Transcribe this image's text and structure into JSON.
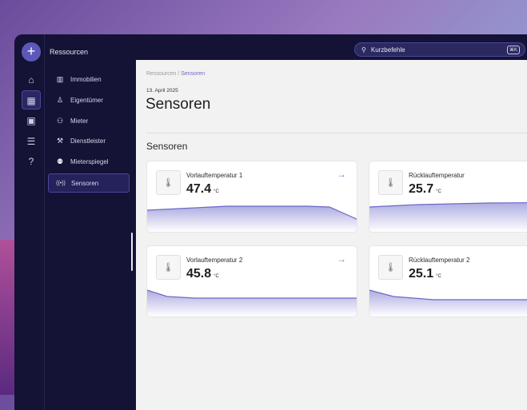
{
  "rail": {
    "add_label": "+",
    "items": [
      {
        "icon": "home-icon",
        "glyph": "⌂"
      },
      {
        "icon": "grid-icon",
        "glyph": "▦",
        "active": true
      },
      {
        "icon": "wallet-icon",
        "glyph": "▣"
      },
      {
        "icon": "sliders-icon",
        "glyph": "☰"
      },
      {
        "icon": "help-icon",
        "glyph": "?"
      }
    ]
  },
  "nav": {
    "title": "Ressourcen",
    "items": [
      {
        "label": "Immobilien",
        "icon": "building-icon",
        "glyph": "▥"
      },
      {
        "label": "Eigentümer",
        "icon": "user-icon",
        "glyph": "♙"
      },
      {
        "label": "Mieter",
        "icon": "users-icon",
        "glyph": "⚇"
      },
      {
        "label": "Dienstleister",
        "icon": "service-icon",
        "glyph": "⚒"
      },
      {
        "label": "Mieterspiegel",
        "icon": "group-icon",
        "glyph": "⚉"
      },
      {
        "label": "Sensoren",
        "icon": "sensor-icon",
        "glyph": "((•))",
        "active": true
      }
    ]
  },
  "search": {
    "placeholder": "Kurzbefehle",
    "shortcut": "⌘K"
  },
  "breadcrumb": {
    "root": "Ressourcen",
    "sep": "/",
    "current": "Sensoren"
  },
  "page": {
    "date": "13. April 2025",
    "title": "Sensoren",
    "section": "Sensoren"
  },
  "accent": "#6b68c8",
  "cards": [
    {
      "name": "Vorlauftemperatur 1",
      "value": "47.4",
      "unit": "°C"
    },
    {
      "name": "Rücklauftemperatur",
      "value": "25.7",
      "unit": "°C"
    },
    {
      "name": "Vorlauftemperatur 2",
      "value": "45.8",
      "unit": "°C"
    },
    {
      "name": "Rücklauftemperatur 2",
      "value": "25.1",
      "unit": "°C"
    }
  ]
}
